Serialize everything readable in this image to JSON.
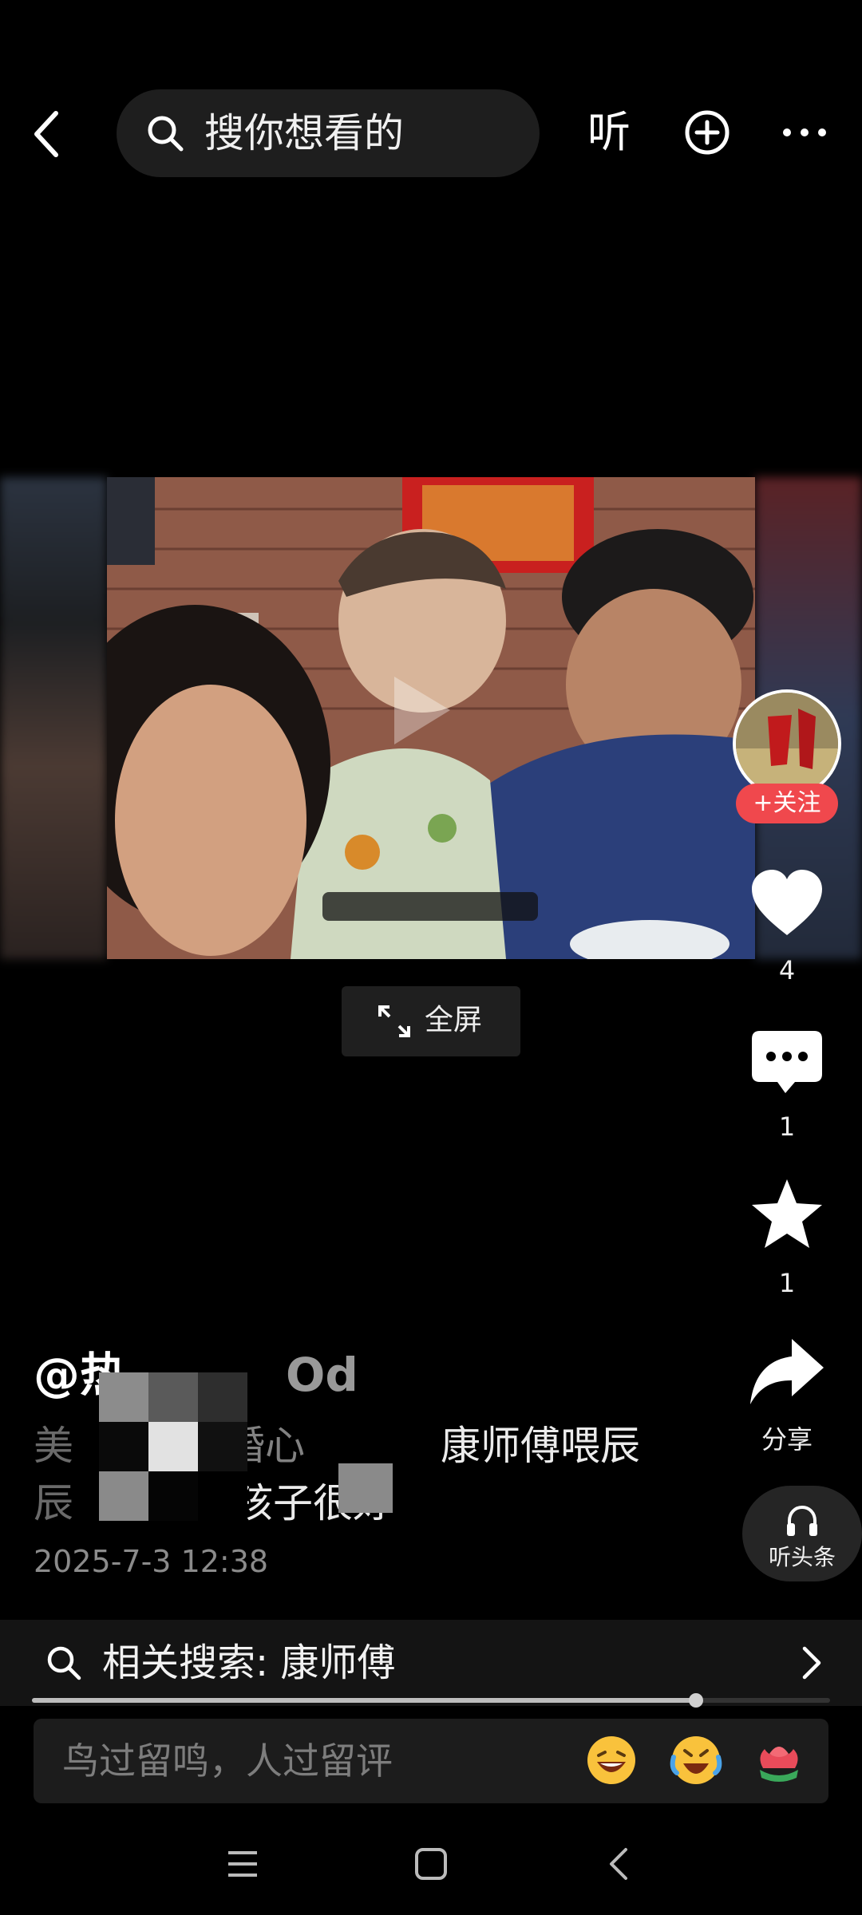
{
  "top_bar": {
    "search_placeholder": "搜你想看的",
    "listen_label": "听"
  },
  "video": {
    "fullscreen_label": "全屏"
  },
  "side_rail": {
    "follow_label": "+关注",
    "like_count": "4",
    "comment_count": "1",
    "favorite_count": "1",
    "share_label": "分享",
    "listen_headline_label": "听头条"
  },
  "post": {
    "author_handle": "@热",
    "author_handle_tail": "Od",
    "caption_line1_a": "美",
    "caption_line1_b": "婚心",
    "caption_line1_c": "康师傅喂辰",
    "caption_line2_a": "辰",
    "caption_line2_b": "对孩子很好",
    "timestamp": "2025-7-3 12:38"
  },
  "related_search": {
    "label": "相关搜索: 康师傅"
  },
  "progress": {
    "played_fraction": 0.832
  },
  "comment_input": {
    "placeholder": "鸟过留鸣，人过留评"
  },
  "colors": {
    "background": "#000000",
    "follow_red": "#f0484d",
    "muted_text": "#8b8b8b"
  },
  "icons": [
    "back-arrow-icon",
    "search-icon",
    "plus-circle-icon",
    "more-icon",
    "expand-icon",
    "heart-icon",
    "comment-icon",
    "star-icon",
    "share-icon",
    "headphones-icon",
    "chevron-right-icon",
    "laugh-emoji-icon",
    "cry-laugh-emoji-icon",
    "rose-emoji-icon",
    "menu-nav-icon",
    "home-nav-icon",
    "back-nav-icon"
  ]
}
